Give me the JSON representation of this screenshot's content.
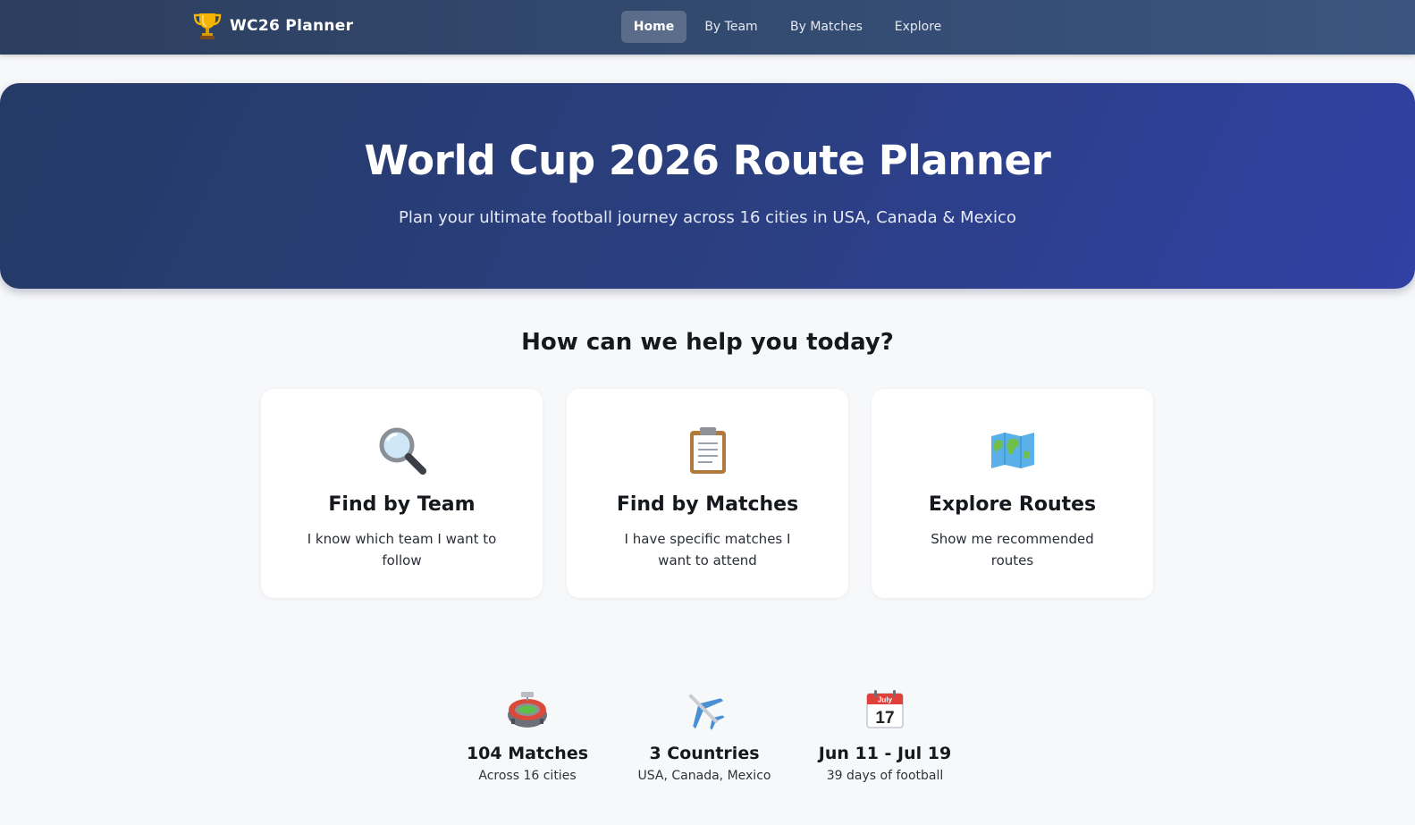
{
  "nav": {
    "brand": "WC26 Planner",
    "brand_icon": "trophy-icon",
    "links": [
      {
        "label": "Home",
        "active": true
      },
      {
        "label": "By Team",
        "active": false
      },
      {
        "label": "By Matches",
        "active": false
      },
      {
        "label": "Explore",
        "active": false
      }
    ]
  },
  "hero": {
    "title": "World Cup 2026 Route Planner",
    "subtitle": "Plan your ultimate football journey across 16 cities in USA, Canada & Mexico"
  },
  "section": {
    "title": "How can we help you today?"
  },
  "cards": [
    {
      "icon": "magnifier-icon",
      "title": "Find by Team",
      "description": "I know which team I want to follow"
    },
    {
      "icon": "clipboard-icon",
      "title": "Find by Matches",
      "description": "I have specific matches I want to attend"
    },
    {
      "icon": "world-map-icon",
      "title": "Explore Routes",
      "description": "Show me recommended routes"
    }
  ],
  "stats": [
    {
      "icon": "stadium-icon",
      "value": "104 Matches",
      "label": "Across 16 cities"
    },
    {
      "icon": "airplane-icon",
      "value": "3 Countries",
      "label": "USA, Canada, Mexico"
    },
    {
      "icon": "calendar-icon",
      "value": "Jun 11 - Jul 19",
      "label": "39 days of football",
      "calendar_month": "July",
      "calendar_day": "17"
    }
  ],
  "colors": {
    "nav_bg": "#2c3e5f",
    "hero_start": "#253a66",
    "hero_end": "#3040a4",
    "page_bg": "#f7f8fa"
  }
}
